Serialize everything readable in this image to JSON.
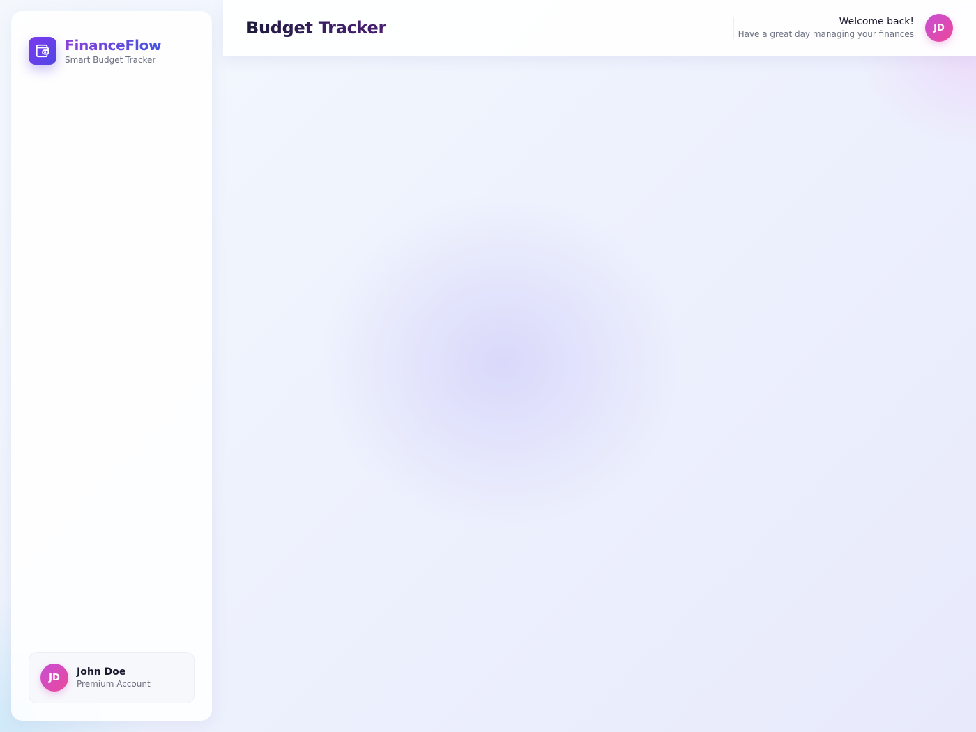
{
  "brand": {
    "name": "FinanceFlow",
    "tagline": "Smart Budget Tracker",
    "logo_icon": "wallet-icon"
  },
  "header": {
    "title": "Budget Tracker",
    "welcome_title": "Welcome back!",
    "welcome_subtitle": "Have a great day managing your finances",
    "avatar_initials": "JD"
  },
  "user": {
    "initials": "JD",
    "name": "John Doe",
    "plan": "Premium Account"
  },
  "colors": {
    "brand_gradient_start": "#7c3aed",
    "brand_gradient_end": "#4f46e5",
    "avatar_gradient_start": "#c64fd6",
    "avatar_gradient_end": "#ec4899"
  }
}
